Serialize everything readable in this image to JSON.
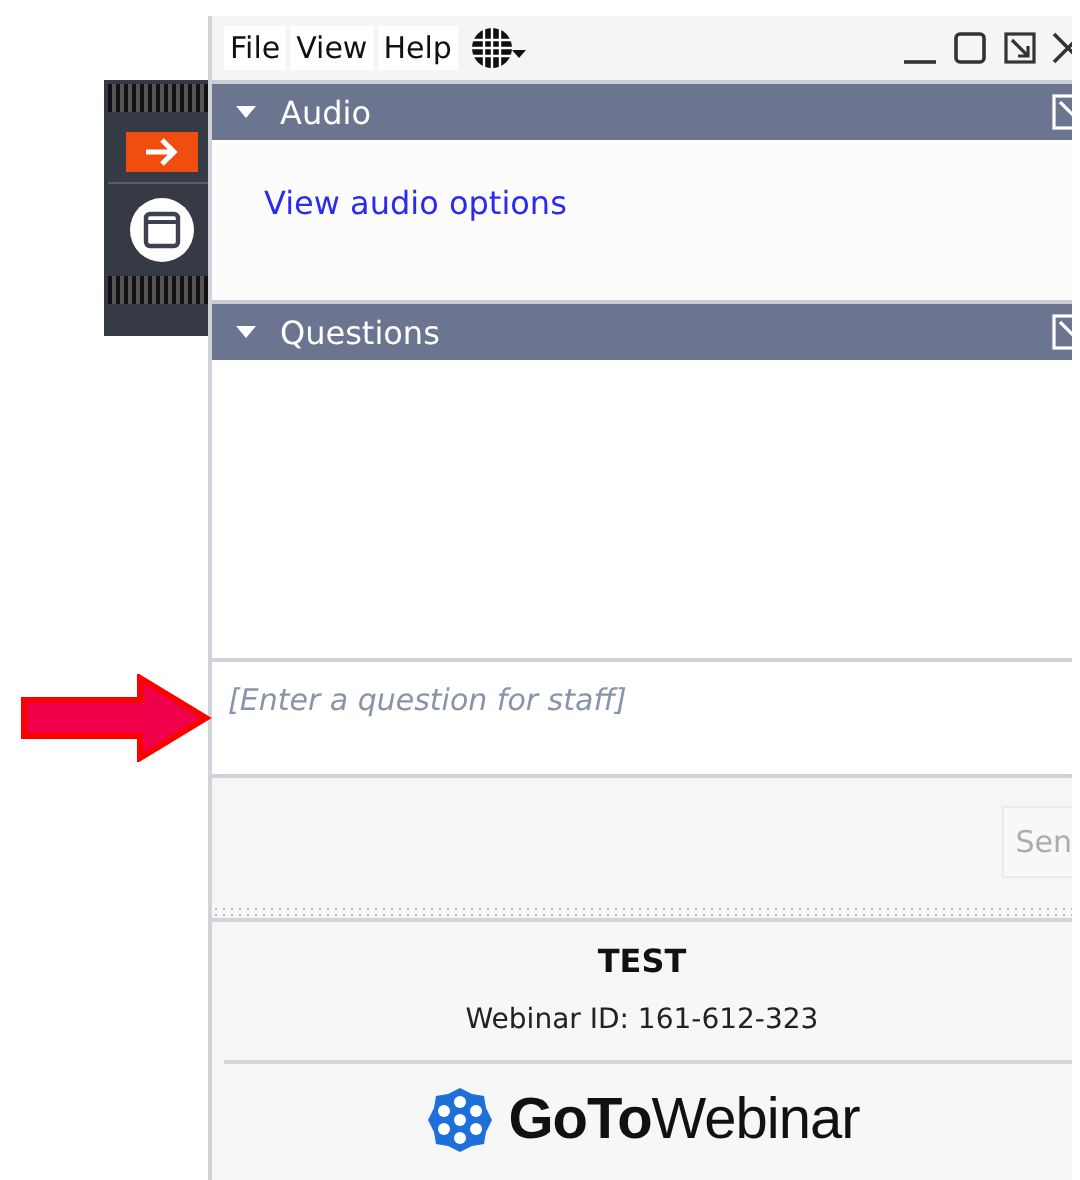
{
  "menu": [
    {
      "label": "File"
    },
    {
      "label": "View"
    },
    {
      "label": "Help"
    }
  ],
  "panes": [
    {
      "title": "Audio",
      "expanded": true
    },
    {
      "title": "Questions",
      "expanded": true
    }
  ],
  "audio": {
    "link": "View audio options"
  },
  "question_input": {
    "placeholder": "[Enter a question for staff]"
  },
  "send_button": "Sen",
  "footer": {
    "title": "TEST",
    "webinar_id": "Webinar ID: 161-612-323",
    "brand": "**GoTo**Webinar"
  }
}
